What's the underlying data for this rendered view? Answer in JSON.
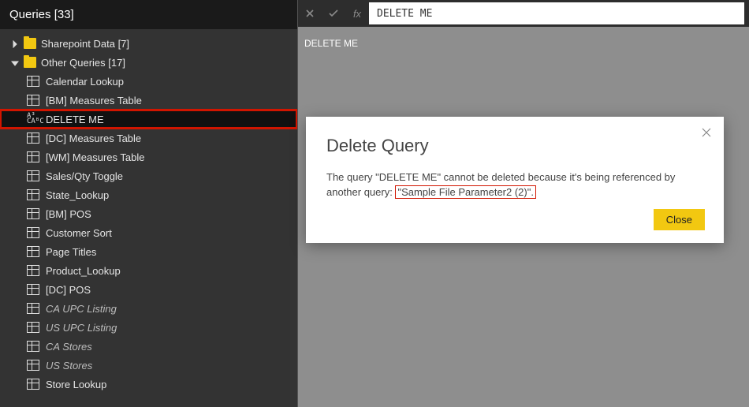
{
  "sidebar": {
    "header": "Queries [33]",
    "folders": [
      {
        "name": "Sharepoint Data [7]",
        "expanded": false
      },
      {
        "name": "Other Queries [17]",
        "expanded": true
      }
    ],
    "items": [
      {
        "label": "Calendar Lookup",
        "icon": "table",
        "italic": false
      },
      {
        "label": "[BM] Measures Table",
        "icon": "table",
        "italic": false
      },
      {
        "label": "DELETE ME",
        "icon": "abc",
        "italic": false,
        "selected": true,
        "redbox": true
      },
      {
        "label": "[DC] Measures Table",
        "icon": "table",
        "italic": false
      },
      {
        "label": "[WM] Measures Table",
        "icon": "table",
        "italic": false
      },
      {
        "label": "Sales/Qty Toggle",
        "icon": "table",
        "italic": false
      },
      {
        "label": "State_Lookup",
        "icon": "table",
        "italic": false
      },
      {
        "label": "[BM] POS",
        "icon": "table",
        "italic": false
      },
      {
        "label": "Customer Sort",
        "icon": "table",
        "italic": false
      },
      {
        "label": "Page Titles",
        "icon": "table",
        "italic": false
      },
      {
        "label": "Product_Lookup",
        "icon": "table",
        "italic": false
      },
      {
        "label": "[DC] POS",
        "icon": "table",
        "italic": false
      },
      {
        "label": "CA UPC Listing",
        "icon": "table",
        "italic": true
      },
      {
        "label": "US UPC Listing",
        "icon": "table",
        "italic": true
      },
      {
        "label": "CA Stores",
        "icon": "table",
        "italic": true
      },
      {
        "label": "US Stores",
        "icon": "table",
        "italic": true
      },
      {
        "label": "Store Lookup",
        "icon": "table",
        "italic": false
      }
    ]
  },
  "formula_bar": {
    "value": "DELETE ME",
    "fx": "fx"
  },
  "query_label": "DELETE ME",
  "dialog": {
    "title": "Delete Query",
    "body_prefix": "The query \"DELETE ME\" cannot be deleted because it's being referenced by another query: ",
    "highlight": "\"Sample File Parameter2 (2)\".",
    "close_label": "Close"
  }
}
